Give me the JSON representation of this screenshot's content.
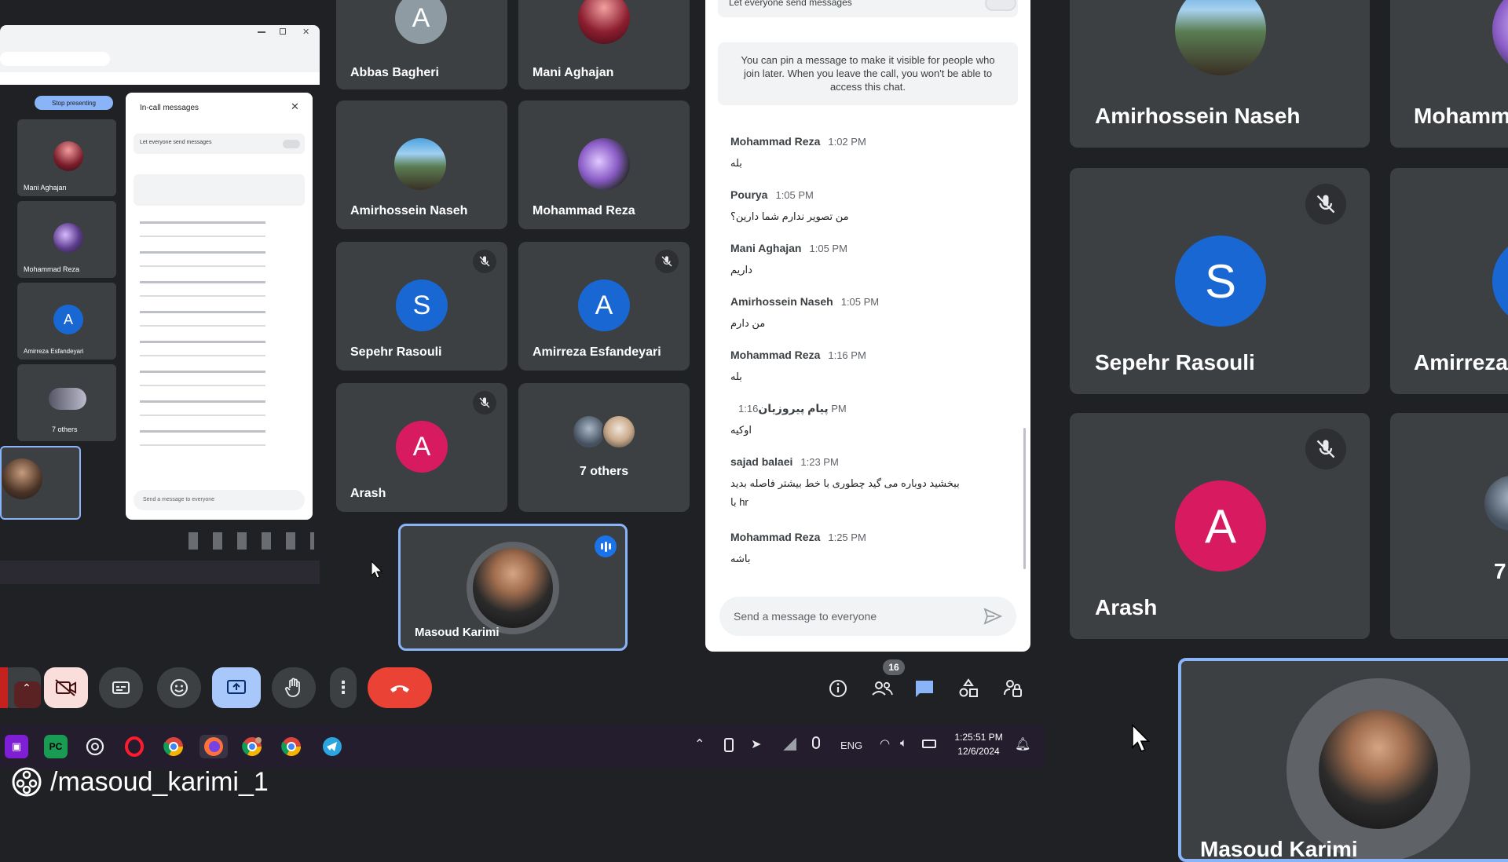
{
  "colors": {
    "bg": "#202124",
    "tile": "#3c4043",
    "speaking_border": "#8ab4f8",
    "end_call": "#ea4335",
    "avatar_grey": "#8e9ba2",
    "avatar_blue": "#1967d2",
    "avatar_pink": "#d81b60",
    "present_active": "#a8c7fa"
  },
  "small_grid": [
    {
      "name": "Abbas Bagheri",
      "initial": "A",
      "muted": false,
      "avatar": "grey"
    },
    {
      "name": "Mani Aghajan",
      "initial": "",
      "muted": false,
      "avatar": "photo"
    },
    {
      "name": "Amirhossein Naseh",
      "initial": "",
      "muted": false,
      "avatar": "mountain"
    },
    {
      "name": "Mohammad Reza",
      "initial": "",
      "muted": false,
      "avatar": "car"
    },
    {
      "name": "Sepehr Rasouli",
      "initial": "S",
      "muted": true,
      "avatar": "blue"
    },
    {
      "name": "Amirreza Esfandeyari",
      "initial": "A",
      "muted": true,
      "avatar": "blue"
    },
    {
      "name": "Arash",
      "initial": "A",
      "muted": true,
      "avatar": "pink"
    },
    {
      "name": "7 others",
      "initial": "",
      "muted": false,
      "avatar": "group"
    }
  ],
  "self_tile": {
    "name": "Masoud Karimi"
  },
  "chat": {
    "toggle_label": "Let everyone send messages",
    "pin_notice": "You can pin a message to make it visible for people who join later. When you leave the call, you won't be able to access this chat.",
    "messages": [
      {
        "sender": "Mohammad Reza",
        "time": "1:02 PM",
        "lines": [
          "بله"
        ]
      },
      {
        "sender": "Pourya",
        "time": "1:05 PM",
        "lines": [
          "من تصویر ندارم شما دارین؟"
        ]
      },
      {
        "sender": "Mani Aghajan",
        "time": "1:05 PM",
        "lines": [
          "داریم"
        ]
      },
      {
        "sender": "Amirhossein Naseh",
        "time": "1:05 PM",
        "lines": [
          "من دارم"
        ]
      },
      {
        "sender": "Mohammad Reza",
        "time": "1:16 PM",
        "lines": [
          "بله"
        ]
      },
      {
        "sender": "پیام پیروزیان",
        "time": "1:16 PM",
        "lines": [
          "اوکیه"
        ]
      },
      {
        "sender": "sajad balaei",
        "time": "1:23 PM",
        "lines": [
          "ببخشید دوباره می گید چطوری با خط بیشتر فاصله بدید",
          "با hr"
        ]
      },
      {
        "sender": "Mohammad Reza",
        "time": "1:25 PM",
        "lines": [
          "باشه"
        ]
      }
    ],
    "input_placeholder": "Send a message to everyone"
  },
  "toolbar": {
    "participants_count": "16"
  },
  "taskbar": {
    "lang": "ENG",
    "time": "1:25:51 PM",
    "date": "12/6/2024"
  },
  "big_grid": [
    {
      "name": "Amirhossein Naseh",
      "avatar": "mountain",
      "muted": false
    },
    {
      "name": "Mohamm",
      "avatar": "car",
      "muted": false
    },
    {
      "name": "Sepehr Rasouli",
      "initial": "S",
      "avatar": "blue",
      "muted": true
    },
    {
      "name": "Amirreza",
      "initial": "A",
      "avatar": "blue",
      "muted": false
    },
    {
      "name": "Arash",
      "initial": "A",
      "avatar": "pink",
      "muted": true
    },
    {
      "name": "7",
      "avatar": "group",
      "muted": false
    }
  ],
  "big_self": {
    "name": "Masoud Karimi"
  },
  "watermark": "/masoud_karimi_1",
  "inner_screen": {
    "stop_presenting": "Stop presenting",
    "panel_title": "In-call messages",
    "toggle": "Let everyone send messages",
    "tiles": [
      "Mani Aghajan",
      "Mohammad Reza",
      "Amirreza Esfandeyari",
      "7 others"
    ],
    "input": "Send a message to everyone"
  }
}
